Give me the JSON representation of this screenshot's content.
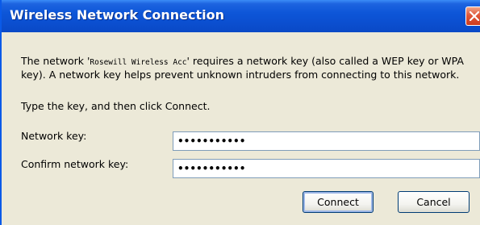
{
  "window": {
    "title": "Wireless Network Connection",
    "close_icon": "close-icon"
  },
  "body": {
    "line1_pre": "The network '",
    "network_name": "Rosewill Wireless Acc",
    "line1_post": "' requires a network key (also called a WEP key or WPA",
    "line2": "key). A network key helps prevent unknown intruders from connecting to this network.",
    "instruction": "Type the key, and then click Connect."
  },
  "form": {
    "network_key_label": "Network key:",
    "network_key_value": "•••••••••••",
    "confirm_key_label": "Confirm network key:",
    "confirm_key_value": "•••••••••••"
  },
  "buttons": {
    "connect": "Connect",
    "cancel": "Cancel"
  },
  "colors": {
    "titlebar": "#0b4fd0",
    "dialog_bg": "#ece9d8",
    "close_button": "#e0583a"
  }
}
